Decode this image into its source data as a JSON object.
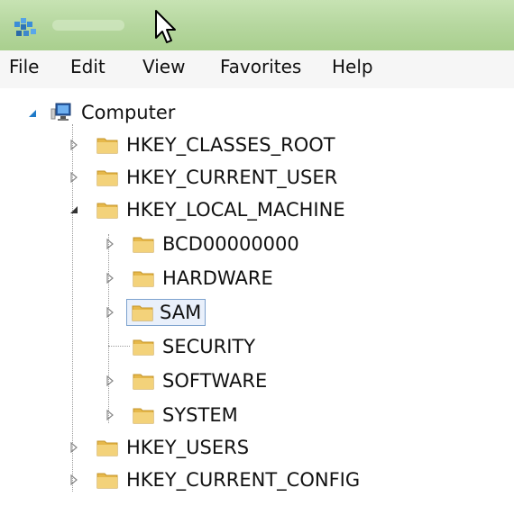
{
  "window": {
    "app_icon": "regedit-icon",
    "cursor_icon": "mouse-pointer-icon",
    "accent_title_gradient": [
      "#c7e3b3",
      "#a9cf8e"
    ]
  },
  "menu": {
    "items": [
      "File",
      "Edit",
      "View",
      "Favorites",
      "Help"
    ]
  },
  "tree": {
    "root": "Computer",
    "hives": {
      "classes_root": "HKEY_CLASSES_ROOT",
      "current_user": "HKEY_CURRENT_USER",
      "local_machine": "HKEY_LOCAL_MACHINE",
      "users": "HKEY_USERS",
      "current_config": "HKEY_CURRENT_CONFIG"
    },
    "local_machine_children": [
      "BCD00000000",
      "HARDWARE",
      "SAM",
      "SECURITY",
      "SOFTWARE",
      "SYSTEM"
    ],
    "selected": "SAM",
    "folder_color": "#e6b84a",
    "expander_color": "#1e7ac8"
  }
}
